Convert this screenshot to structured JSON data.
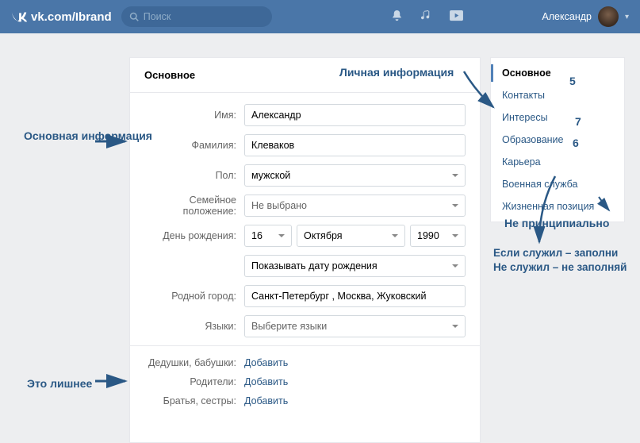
{
  "header": {
    "url": "vk.com/Ibrand",
    "search_placeholder": "Поиск",
    "username": "Александр"
  },
  "form": {
    "title": "Основное",
    "labels": {
      "name": "Имя:",
      "surname": "Фамилия:",
      "gender": "Пол:",
      "marital": "Семейное положение:",
      "dob": "День рождения:",
      "hometown": "Родной город:",
      "languages": "Языки:",
      "grandparents": "Дедушки, бабушки:",
      "parents": "Родители:",
      "siblings": "Братья, сестры:"
    },
    "values": {
      "name": "Александр",
      "surname": "Клеваков",
      "gender": "мужской",
      "marital": "Не выбрано",
      "dob_day": "16",
      "dob_month": "Октября",
      "dob_year": "1990",
      "dob_visibility": "Показывать дату рождения",
      "hometown": "Санкт-Петербург , Москва, Жуковский",
      "languages": "Выберите языки",
      "add": "Добавить"
    }
  },
  "side": [
    "Основное",
    "Контакты",
    "Интересы",
    "Образование",
    "Карьера",
    "Военная служба",
    "Жизненная позиция"
  ],
  "annotations": {
    "personal": "Личная информация",
    "basic": "Основная информация",
    "extra": "Это лишнее",
    "np": "Не принципиально",
    "mil1": "Если служил – заполни",
    "mil2": "Не служил – не заполняй",
    "n5": "5",
    "n6": "6",
    "n7": "7"
  }
}
